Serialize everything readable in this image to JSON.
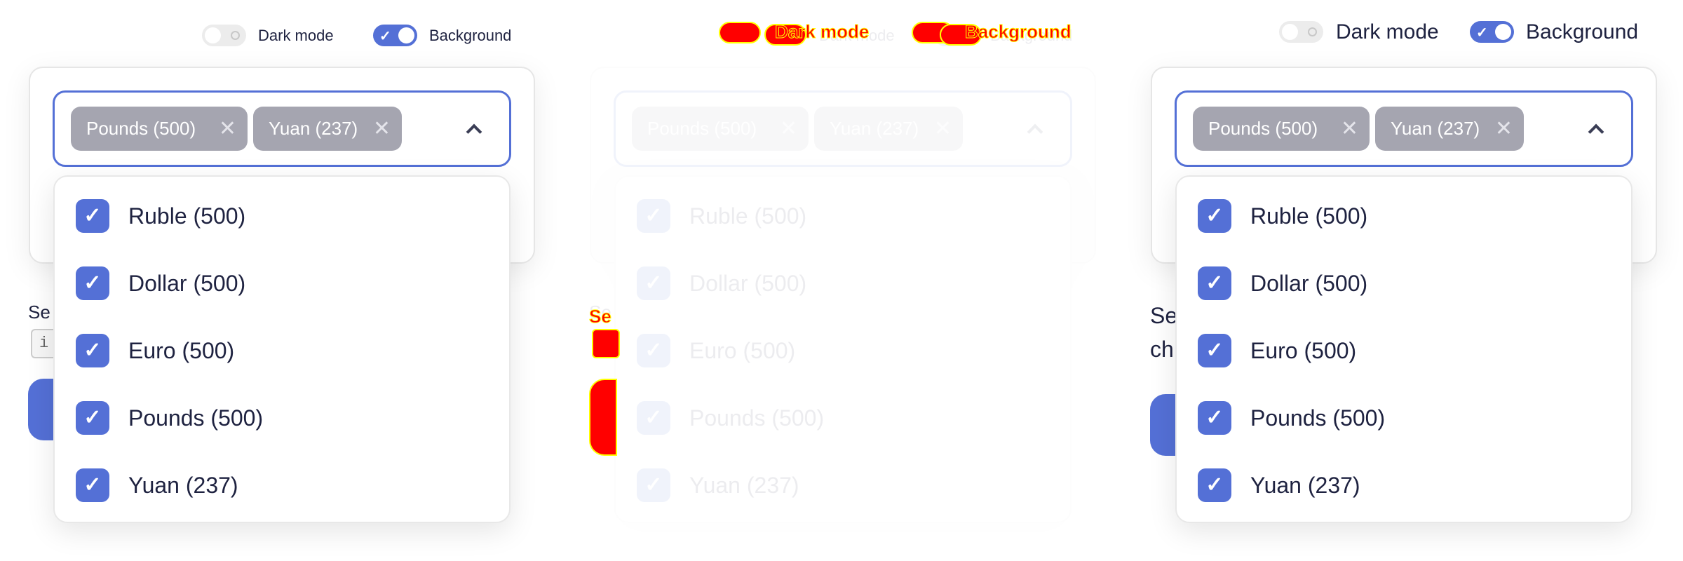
{
  "toggles": {
    "dark_mode": {
      "label": "Dark mode",
      "on": false
    },
    "background": {
      "label": "Background",
      "on": true
    }
  },
  "select": {
    "tags": [
      {
        "label": "Pounds (500)",
        "remove_icon": "close-icon"
      },
      {
        "label": "Yuan (237)",
        "remove_icon": "close-icon"
      }
    ],
    "chevron_icon": "chevron-up-icon",
    "options": [
      {
        "label": "Ruble (500)",
        "checked": true
      },
      {
        "label": "Dollar (500)",
        "checked": true
      },
      {
        "label": "Euro (500)",
        "checked": true
      },
      {
        "label": "Pounds (500)",
        "checked": true
      },
      {
        "label": "Yuan (237)",
        "checked": true
      }
    ]
  },
  "behind": {
    "text_fragment": "Se",
    "text_fragment_2": "ch",
    "input_fragment": "i"
  },
  "colors": {
    "accent": "#5470d6",
    "tag": "#a5a5b0",
    "diff": "#ff0000",
    "diff_outline": "#ffff00"
  }
}
